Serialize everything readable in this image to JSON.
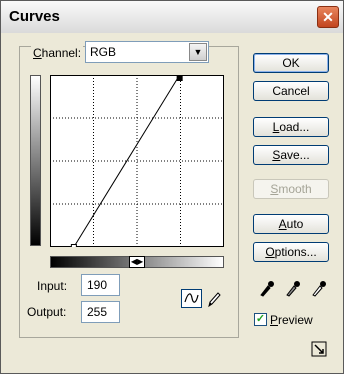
{
  "window": {
    "title": "Curves"
  },
  "channel": {
    "label": "Channel:",
    "mnemonic": "C",
    "rest": "hannel:",
    "value": "RGB"
  },
  "fields": {
    "input": {
      "label": "Input:",
      "value": "190"
    },
    "output": {
      "label": "Output:",
      "value": "255"
    }
  },
  "buttons": {
    "ok": "OK",
    "cancel": "Cancel",
    "load": {
      "mnemonic": "L",
      "rest": "oad..."
    },
    "save": {
      "mnemonic": "S",
      "rest": "ave..."
    },
    "smooth": {
      "mnemonic": "S",
      "rest": "mooth",
      "enabled": false
    },
    "auto": {
      "mnemonic": "A",
      "rest": "uto"
    },
    "options": {
      "mnemonic": "O",
      "rest": "ptions..."
    }
  },
  "preview": {
    "mnemonic": "P",
    "rest": "review",
    "checked": true
  },
  "curve": {
    "points": [
      [
        0,
        0
      ],
      [
        35,
        0
      ],
      [
        190,
        255
      ],
      [
        255,
        255
      ]
    ],
    "selected_point": 2
  },
  "icons": [
    "close-icon",
    "curve-tool-icon",
    "pencil-icon",
    "black-eyedropper-icon",
    "gray-eyedropper-icon",
    "white-eyedropper-icon",
    "resize-icon"
  ]
}
